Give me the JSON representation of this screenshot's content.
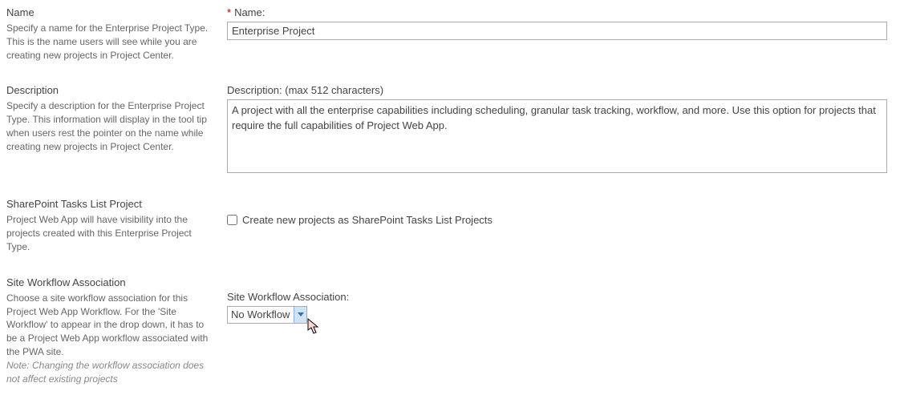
{
  "sections": {
    "name": {
      "title": "Name",
      "help": "Specify a name for the Enterprise Project Type. This is the name users will see while you are creating new projects in Project Center.",
      "field_label": "Name:",
      "value": "Enterprise Project"
    },
    "description": {
      "title": "Description",
      "help": "Specify a description for the Enterprise Project Type. This information will display in the tool tip when users rest the pointer on the name while creating new projects in Project Center.",
      "field_label": "Description: (max 512 characters)",
      "value": "A project with all the enterprise capabilities including scheduling, granular task tracking, workflow, and more. Use this option for projects that require the full capabilities of Project Web App."
    },
    "sptasks": {
      "title": "SharePoint Tasks List Project",
      "help": "Project Web App will have visibility into the projects created with this Enterprise Project Type.",
      "checkbox_label": "Create new projects as SharePoint Tasks List Projects",
      "checked": false
    },
    "workflow": {
      "title": "Site Workflow Association",
      "help": "Choose a site workflow association for this Project Web App Workflow. For the 'Site Workflow' to appear in the drop down, it has to be a Project Web App workflow associated with the PWA site.",
      "note": "Note: Changing the workflow association does not affect existing projects",
      "field_label": "Site Workflow Association:",
      "selected": "No Workflow"
    }
  }
}
